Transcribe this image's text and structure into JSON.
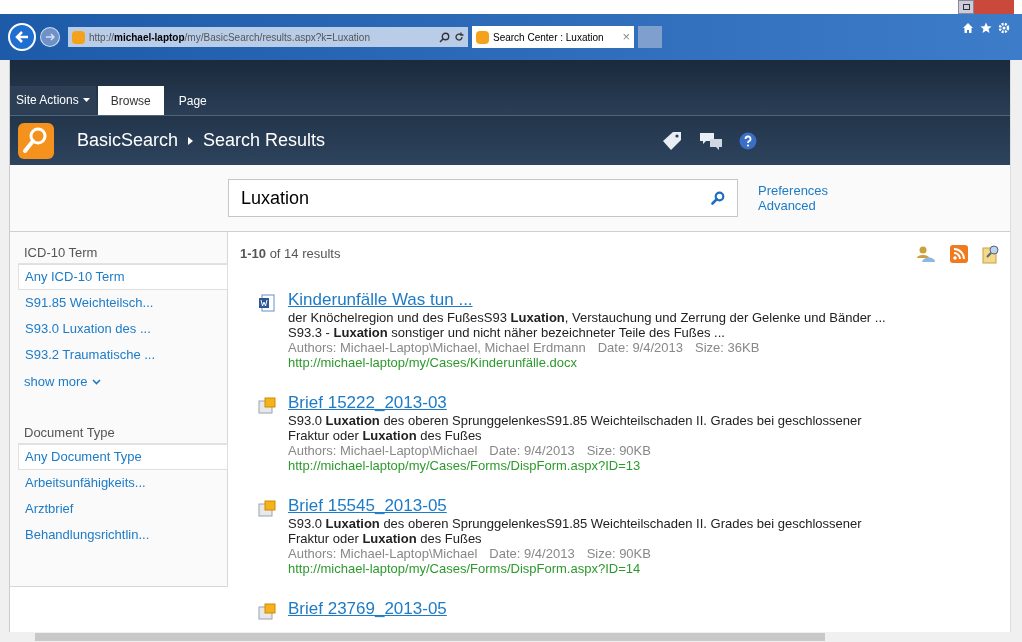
{
  "browser": {
    "address_prefix": "http://",
    "address_host": "michael-laptop",
    "address_path": "/my/BasicSearch/results.aspx?k=Luxation",
    "tabs": [
      {
        "label": "Search Center : Luxation",
        "selected": true,
        "close": "×"
      }
    ]
  },
  "ribbon": {
    "site_actions": "Site Actions",
    "tabs": [
      {
        "label": "Browse",
        "selected": true
      },
      {
        "label": "Page",
        "selected": false
      }
    ]
  },
  "title_bar": {
    "site": "BasicSearch",
    "page": "Search Results"
  },
  "search": {
    "value": "Luxation",
    "links": [
      "Preferences",
      "Advanced"
    ]
  },
  "refiners": [
    {
      "heading": "ICD-10 Term",
      "items": [
        {
          "label": "Any ICD-10 Term",
          "selected": true
        },
        {
          "label": "S91.85 Weichteilsch...",
          "selected": false
        },
        {
          "label": "S93.0 Luxation des ...",
          "selected": false
        },
        {
          "label": "S93.2 Traumatische ...",
          "selected": false
        }
      ],
      "show_more": "show more"
    },
    {
      "heading": "Document Type",
      "items": [
        {
          "label": "Any Document Type",
          "selected": true
        },
        {
          "label": "Arbeitsunfähigkeits...",
          "selected": false
        },
        {
          "label": "Arztbrief",
          "selected": false
        },
        {
          "label": "Behandlungsrichtlin...",
          "selected": false
        }
      ]
    }
  ],
  "results_count": "**1-10** of 14 results",
  "results": [
    {
      "kind": "word",
      "title": "Kinderunfälle Was tun ...",
      "summary": [
        "der Knöchelregion und des FußesS93 **Luxation**, Verstauchung und Zerrung der Gelenke und Bänder ...",
        "S93.3 - **Luxation** sonstiger und nicht näher bezeichneter Teile des Fußes ..."
      ],
      "meta": [
        "Authors: Michael-Laptop\\Michael, Michael Erdmann",
        "Date: 9/4/2013",
        "Size: 36KB"
      ],
      "url": "http://michael-laptop/my/Cases/Kinderunfälle.docx"
    },
    {
      "kind": "item",
      "title": "Brief 15222_2013-03",
      "summary": [
        "S93.0 **Luxation** des oberen SprunggelenkesS91.85 Weichteilschaden II. Grades bei geschlossener",
        "Fraktur oder **Luxation** des Fußes"
      ],
      "meta": [
        "Authors: Michael-Laptop\\Michael",
        "Date: 9/4/2013",
        "Size: 90KB"
      ],
      "url": "http://michael-laptop/my/Cases/Forms/DispForm.aspx?ID=13"
    },
    {
      "kind": "item",
      "title": "Brief 15545_2013-05",
      "summary": [
        "S93.0 **Luxation** des oberen SprunggelenkesS91.85 Weichteilschaden II. Grades bei geschlossener",
        "Fraktur oder **Luxation** des Fußes"
      ],
      "meta": [
        "Authors: Michael-Laptop\\Michael",
        "Date: 9/4/2013",
        "Size: 90KB"
      ],
      "url": "http://michael-laptop/my/Cases/Forms/DispForm.aspx?ID=14"
    },
    {
      "kind": "item",
      "title": "Brief 23769_2013-05"
    }
  ]
}
